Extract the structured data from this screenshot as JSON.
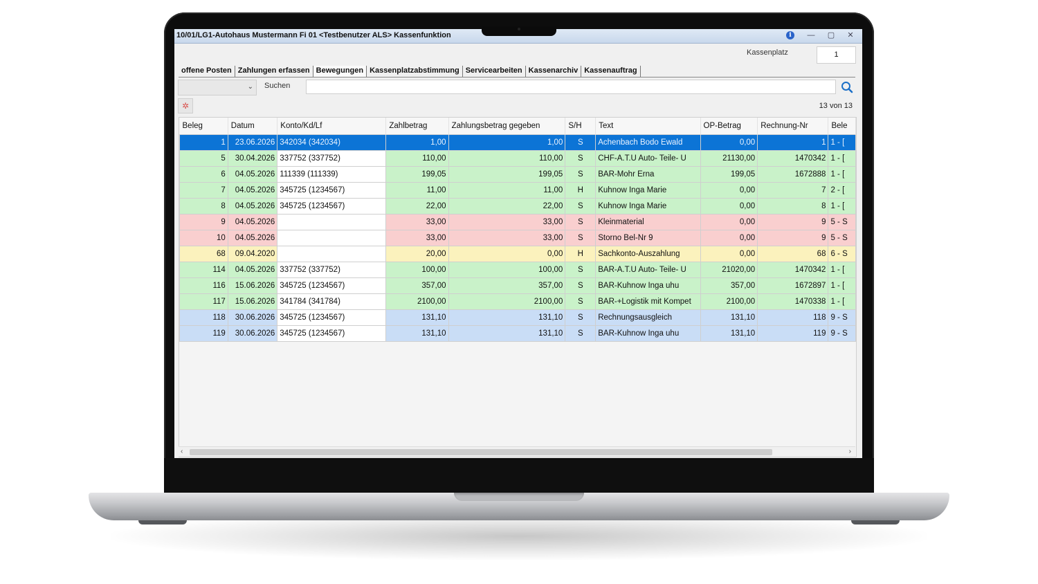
{
  "window": {
    "title": "10/01/LG1-Autohaus Mustermann Fi 01 <Testbenutzer ALS> Kassenfunktion",
    "info_glyph": "i",
    "minimize_glyph": "—",
    "maximize_glyph": "▢",
    "close_glyph": "✕"
  },
  "kassenplatz": {
    "label": "Kassenplatz",
    "value": "1"
  },
  "tabs": [
    {
      "label": "offene Posten"
    },
    {
      "label": "Zahlungen erfassen"
    },
    {
      "label": "Bewegungen"
    },
    {
      "label": "Kassenplatzabstimmung"
    },
    {
      "label": "Servicearbeiten"
    },
    {
      "label": "Kassenarchiv"
    },
    {
      "label": "Kassenauftrag"
    }
  ],
  "active_tab": "Bewegungen",
  "search": {
    "label": "Suchen",
    "value": "",
    "combo_value": ""
  },
  "count_text": "13 von 13",
  "columns": [
    "Beleg",
    "Datum",
    "Konto/Kd/Lf",
    "Zahlbetrag",
    "Zahlungsbetrag gegeben",
    "S/H",
    "Text",
    "OP-Betrag",
    "Rechnung-Nr",
    "Bele"
  ],
  "rows": [
    {
      "color": "sel",
      "beleg": "1",
      "datum": "23.06.2026",
      "konto": "342034 (342034)",
      "zahl": "1,00",
      "gegeben": "1,00",
      "sh": "S",
      "text": "Achenbach Bodo Ewald",
      "op": "0,00",
      "rech": "1",
      "bele": "1 - ["
    },
    {
      "color": "green",
      "beleg": "5",
      "datum": "30.04.2026",
      "konto": "337752 (337752)",
      "zahl": "110,00",
      "gegeben": "110,00",
      "sh": "S",
      "text": "CHF-A.T.U Auto- Teile- U",
      "op": "21130,00",
      "rech": "1470342",
      "bele": "1 - ["
    },
    {
      "color": "green",
      "beleg": "6",
      "datum": "04.05.2026",
      "konto": "111339 (111339)",
      "zahl": "199,05",
      "gegeben": "199,05",
      "sh": "S",
      "text": "BAR-Mohr Erna",
      "op": "199,05",
      "rech": "1672888",
      "bele": "1 - ["
    },
    {
      "color": "green",
      "beleg": "7",
      "datum": "04.05.2026",
      "konto": "345725 (1234567)",
      "zahl": "11,00",
      "gegeben": "11,00",
      "sh": "H",
      "text": "Kuhnow Inga Marie",
      "op": "0,00",
      "rech": "7",
      "bele": "2 - ["
    },
    {
      "color": "green",
      "beleg": "8",
      "datum": "04.05.2026",
      "konto": "345725 (1234567)",
      "zahl": "22,00",
      "gegeben": "22,00",
      "sh": "S",
      "text": "Kuhnow Inga Marie",
      "op": "0,00",
      "rech": "8",
      "bele": "1 - ["
    },
    {
      "color": "red",
      "beleg": "9",
      "datum": "04.05.2026",
      "konto": "",
      "zahl": "33,00",
      "gegeben": "33,00",
      "sh": "S",
      "text": "Kleinmaterial",
      "op": "0,00",
      "rech": "9",
      "bele": "5 - S"
    },
    {
      "color": "red",
      "beleg": "10",
      "datum": "04.05.2026",
      "konto": "",
      "zahl": "33,00",
      "gegeben": "33,00",
      "sh": "S",
      "text": "Storno Bel-Nr 9",
      "op": "0,00",
      "rech": "9",
      "bele": "5 - S"
    },
    {
      "color": "yellow",
      "beleg": "68",
      "datum": "09.04.2020",
      "konto": "",
      "zahl": "20,00",
      "gegeben": "0,00",
      "sh": "H",
      "text": "Sachkonto-Auszahlung",
      "op": "0,00",
      "rech": "68",
      "bele": "6 - S"
    },
    {
      "color": "green",
      "beleg": "114",
      "datum": "04.05.2026",
      "konto": "337752 (337752)",
      "zahl": "100,00",
      "gegeben": "100,00",
      "sh": "S",
      "text": "BAR-A.T.U Auto- Teile- U",
      "op": "21020,00",
      "rech": "1470342",
      "bele": "1 - ["
    },
    {
      "color": "green",
      "beleg": "116",
      "datum": "15.06.2026",
      "konto": "345725 (1234567)",
      "zahl": "357,00",
      "gegeben": "357,00",
      "sh": "S",
      "text": "BAR-Kuhnow Inga uhu",
      "op": "357,00",
      "rech": "1672897",
      "bele": "1 - ["
    },
    {
      "color": "green",
      "beleg": "117",
      "datum": "15.06.2026",
      "konto": "341784 (341784)",
      "zahl": "2100,00",
      "gegeben": "2100,00",
      "sh": "S",
      "text": "BAR-+Logistik mit Kompet",
      "op": "2100,00",
      "rech": "1470338",
      "bele": "1 - ["
    },
    {
      "color": "blue",
      "beleg": "118",
      "datum": "30.06.2026",
      "konto": "345725 (1234567)",
      "zahl": "131,10",
      "gegeben": "131,10",
      "sh": "S",
      "text": "Rechnungsausgleich",
      "op": "131,10",
      "rech": "118",
      "bele": "9 - S"
    },
    {
      "color": "blue",
      "beleg": "119",
      "datum": "30.06.2026",
      "konto": "345725 (1234567)",
      "zahl": "131,10",
      "gegeben": "131,10",
      "sh": "S",
      "text": "BAR-Kuhnow Inga uhu",
      "op": "131,10",
      "rech": "119",
      "bele": "9 - S"
    }
  ],
  "icons": {
    "search": "search-icon",
    "filter": "filter-clear-icon",
    "combo": "chevron-down-icon",
    "scroll_left": "chevron-left-icon",
    "scroll_right": "chevron-right-icon"
  },
  "colors": {
    "selected_row": "#0c74d6",
    "green_row": "#c9f2c9",
    "red_row": "#f9cfcf",
    "yellow_row": "#fbf2bd",
    "blue_row": "#c9ddf6"
  }
}
